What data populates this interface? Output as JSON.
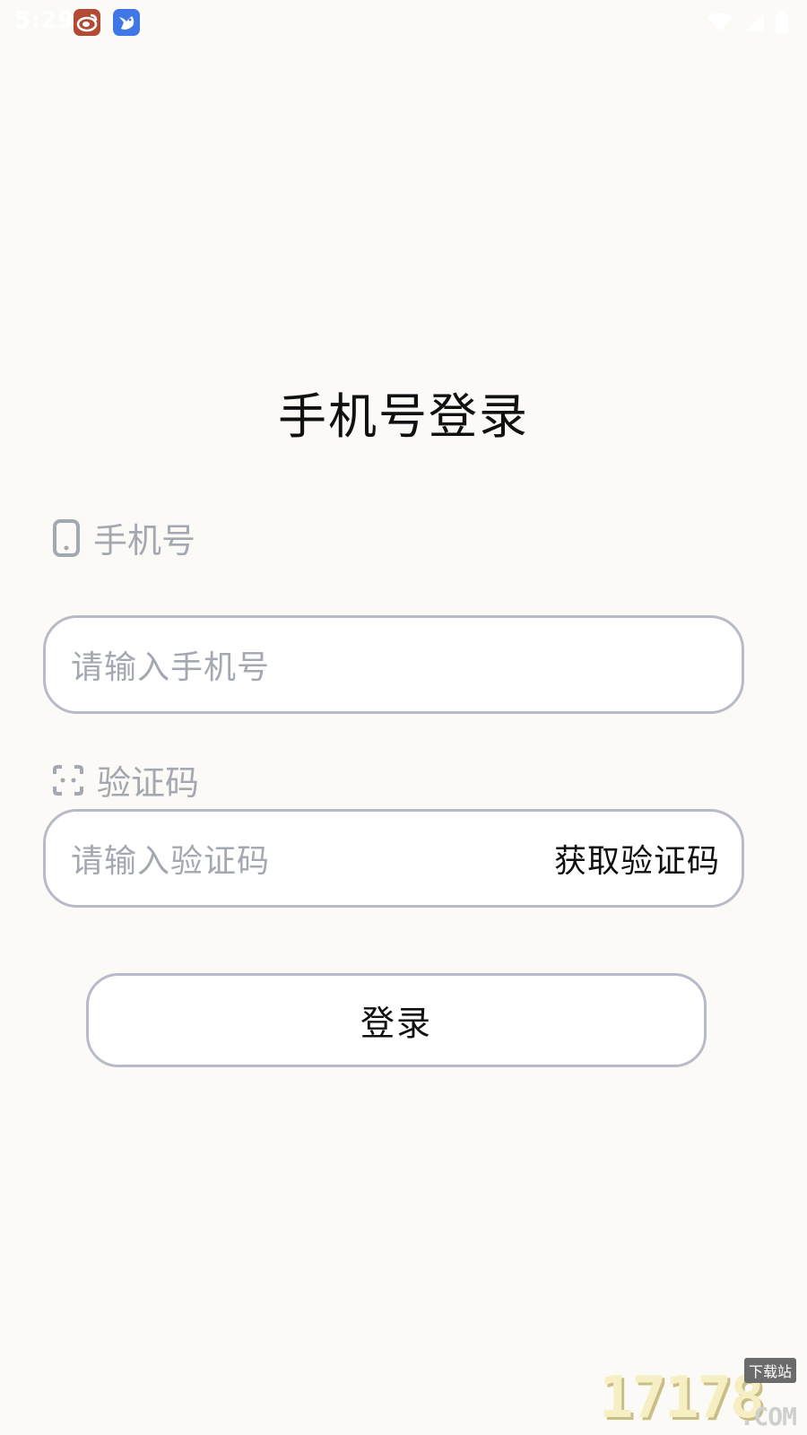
{
  "status_bar": {
    "time": "5:29",
    "notification_icons": [
      "weibo-icon",
      "bird-app-icon"
    ],
    "system_icons": [
      "wifi-icon",
      "cellular-signal-icon",
      "battery-icon"
    ]
  },
  "title": "手机号登录",
  "phone": {
    "label": "手机号",
    "icon": "phone-icon",
    "placeholder": "请输入手机号"
  },
  "code": {
    "label": "验证码",
    "icon": "scan-code-icon",
    "placeholder": "请输入验证码",
    "get_code_label": "获取验证码"
  },
  "login_button": {
    "label": "登录"
  },
  "watermark": {
    "number": "17178",
    "badge": "下载站",
    "suffix": ".COM"
  },
  "colors": {
    "background": "#fbfaf7",
    "border": "#b8bbc7",
    "muted_text": "#a3a8b1",
    "primary_text": "#101010"
  }
}
